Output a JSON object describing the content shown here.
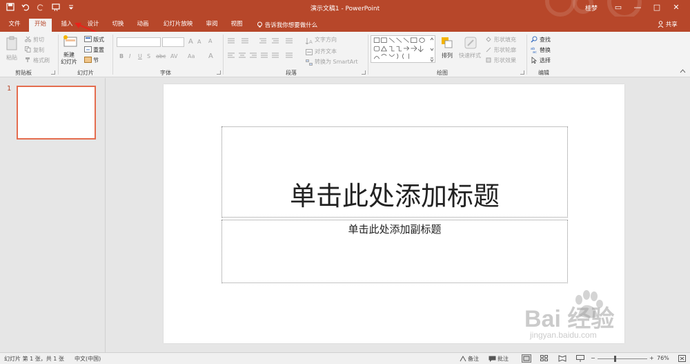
{
  "titlebar": {
    "doc_title": "演示文稿1  -  PowerPoint",
    "user": "桂梦",
    "minimize": "—",
    "restore": "□",
    "close": "✕",
    "ribbon_opts": "▭"
  },
  "quick_access": {
    "save_icon": "save-icon",
    "undo_icon": "undo-icon",
    "redo_icon": "redo-icon",
    "start_icon": "start-slideshow-icon",
    "customize_icon": "customize-icon"
  },
  "tabs": {
    "file": "文件",
    "home": "开始",
    "insert": "插入",
    "design": "设计",
    "transitions": "切换",
    "animations": "动画",
    "slideshow": "幻灯片放映",
    "review": "审阅",
    "view": "视图",
    "tell_me": "告诉我你想要做什么",
    "share": "共享"
  },
  "clipboard": {
    "paste": "粘贴",
    "cut": "剪切",
    "copy": "复制",
    "format_painter": "格式刷",
    "label": "剪贴板"
  },
  "slides_group": {
    "new_slide_1": "新建",
    "new_slide_2": "幻灯片",
    "layout": "版式",
    "reset": "重置",
    "section": "节",
    "label": "幻灯片"
  },
  "font_group": {
    "label": "字体",
    "bold": "B",
    "italic": "I",
    "underline": "U",
    "shadow": "S",
    "strike": "abc",
    "spacing": "AV",
    "case": "Aa",
    "font_color": "A",
    "grow": "A",
    "shrink": "A",
    "clear": "A"
  },
  "paragraph_group": {
    "label": "段落",
    "text_direction": "文字方向",
    "align_text": "对齐文本",
    "smartart": "转换为 SmartArt"
  },
  "drawing_group": {
    "label": "绘图",
    "arrange": "排列",
    "quick_styles": "快速样式",
    "shape_fill": "形状填充",
    "shape_outline": "形状轮廓",
    "shape_effects": "形状效果"
  },
  "editing_group": {
    "label": "编辑",
    "find": "查找",
    "replace": "替换",
    "select": "选择"
  },
  "thumbnail": {
    "number": "1"
  },
  "slide": {
    "title_placeholder": "单击此处添加标题",
    "subtitle_placeholder": "单击此处添加副标题"
  },
  "statusbar": {
    "slide_info": "幻灯片 第 1 张，共 1 张",
    "language": "中文(中国)",
    "notes": "备注",
    "comments": "批注",
    "zoom": "76%",
    "zoom_minus": "−",
    "zoom_plus": "+"
  },
  "watermark": {
    "brand": "Bai 经验",
    "url": "jingyan.baidu.com"
  },
  "colors": {
    "accent": "#b7472a",
    "selection": "#e46c4e",
    "annotation": "#e8231a"
  }
}
